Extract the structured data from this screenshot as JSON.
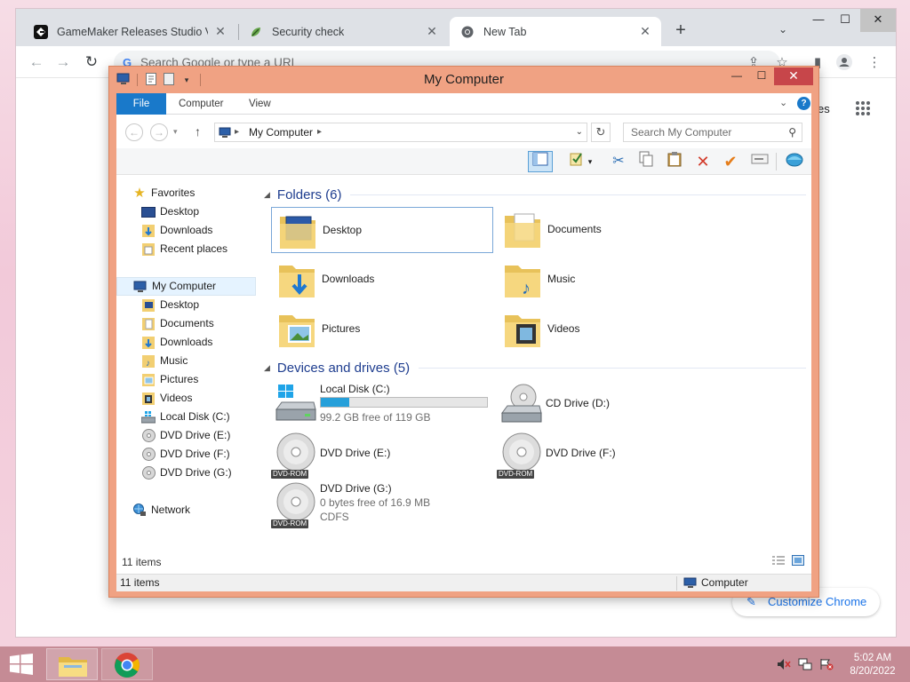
{
  "chrome": {
    "tabs": [
      {
        "title": "GameMaker Releases Studio Versions",
        "close": "✕"
      },
      {
        "title": "Security check",
        "close": "✕"
      },
      {
        "title": "New Tab",
        "close": "✕"
      }
    ],
    "new_tab": "+",
    "tab_search": "⌄",
    "window_controls": {
      "minimize": "—",
      "maximize": "☐",
      "close": "✕"
    },
    "omnibox_placeholder": "Search Google or type a URL",
    "right_partial_text": "es",
    "customize_label": "Customize Chrome"
  },
  "explorer": {
    "title": "My Computer",
    "controls": {
      "minimize": "—",
      "maximize": "☐",
      "close": "✕"
    },
    "ribbon_tabs": [
      "File",
      "Computer",
      "View"
    ],
    "address": {
      "location": "My Computer"
    },
    "search_placeholder": "Search My Computer",
    "nav": {
      "favorites": "Favorites",
      "favorites_items": [
        "Desktop",
        "Downloads",
        "Recent places"
      ],
      "computer": "My Computer",
      "computer_items": [
        "Desktop",
        "Documents",
        "Downloads",
        "Music",
        "Pictures",
        "Videos",
        "Local Disk (C:)",
        "DVD Drive (E:)",
        "DVD Drive (F:)",
        "DVD Drive (G:)"
      ],
      "network": "Network"
    },
    "folders_header": "Folders (6)",
    "folders": [
      "Desktop",
      "Documents",
      "Downloads",
      "Music",
      "Pictures",
      "Videos"
    ],
    "drives_header": "Devices and drives (5)",
    "drives": [
      {
        "name": "Local Disk (C:)",
        "free": "99.2 GB free of 119 GB",
        "used_fraction": 0.17
      },
      {
        "name": "CD Drive (D:)"
      },
      {
        "name": "DVD Drive (E:)",
        "badge": "DVD-ROM"
      },
      {
        "name": "DVD Drive (F:)",
        "badge": "DVD-ROM"
      },
      {
        "name": "DVD Drive (G:)",
        "free": "0 bytes free of 16.9 MB",
        "fs": "CDFS",
        "badge": "DVD-ROM"
      }
    ],
    "item_count": "11 items",
    "status_count": "11 items",
    "status_location": "Computer"
  },
  "taskbar": {
    "time": "5:02 AM",
    "date": "8/20/2022"
  }
}
